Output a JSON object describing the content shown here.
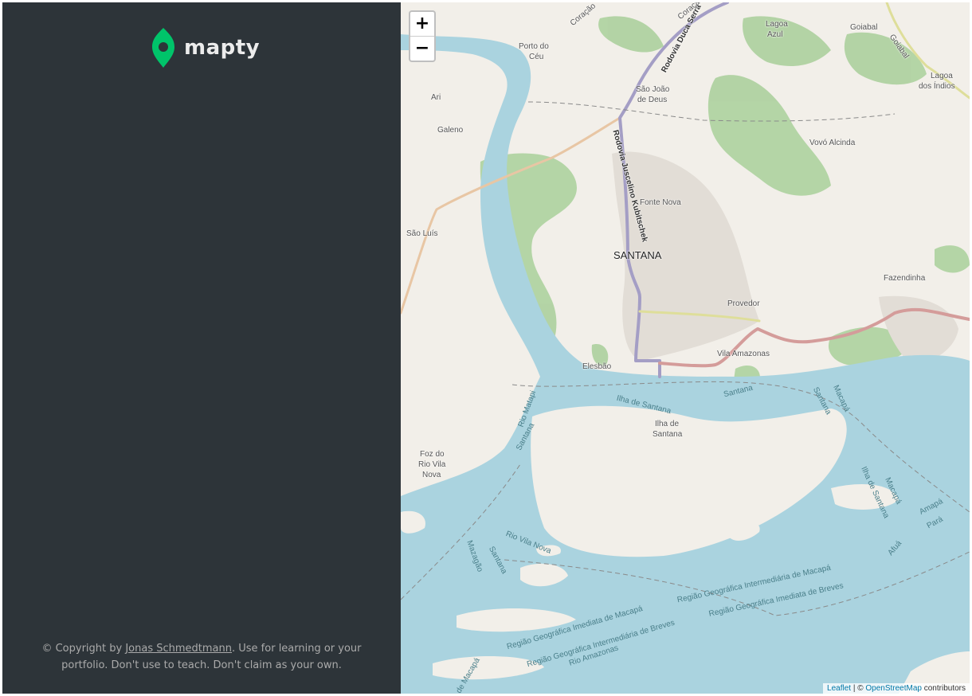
{
  "sidebar": {
    "logo_text": "mapty",
    "copyright": {
      "prefix": "© Copyright by ",
      "author": "Jonas Schmedtmann",
      "suffix": ". Use for learning or your portfolio. Don't use to teach. Don't claim as your own."
    }
  },
  "map": {
    "zoom_in": "+",
    "zoom_out": "−",
    "attribution": {
      "leaflet": "Leaflet",
      "separator": " | © ",
      "osm": "OpenStreetMap",
      "suffix": " contributors"
    },
    "labels": {
      "santana": "SANTANA",
      "fonte_nova": "Fonte Nova",
      "provedor": "Provedor",
      "vila_amazonas": "Vila Amazonas",
      "elesbao": "Elesbão",
      "fazendinha": "Fazendinha",
      "vovo_alcinda": "Vovó Alcinda",
      "sao_joao_line1": "São João",
      "sao_joao_line2": "de Deus",
      "porto_line1": "Porto do",
      "porto_line2": "Céu",
      "ari": "Ari",
      "galeno": "Galeno",
      "sao_luis": "São Luís",
      "lagoa_azul_line1": "Lagoa",
      "lagoa_azul_line2": "Azul",
      "goiabal": "Goiabal",
      "goiabal_road": "Goiabal",
      "lagoa_indios_line1": "Lagoa",
      "lagoa_indios_line2": "dos Índios",
      "ilha_santana_line1": "Ilha de",
      "ilha_santana_line2": "Santana",
      "ilha_santana_water": "Ilha de Santana",
      "foz_line1": "Foz do",
      "foz_line2": "Rio Vila",
      "foz_line3": "Nova",
      "rio_matapi": "Rio Matapi",
      "rio_vila_nova": "Rio Vila Nova",
      "rio_amazonas": "Rio Amazonas",
      "santana_water1": "Santana",
      "santana_water2": "Santana",
      "santana_water3": "Santana",
      "santana_water4": "Santana",
      "macapa_1": "Macapá",
      "macapa_2": "Macapá",
      "ilha_santana_vertical": "Ilha de Santana",
      "amapa": "Amapá",
      "para": "Pará",
      "afua": "Afuá",
      "mazagao": "Mazagão",
      "regiao_inter_macapa": "Região Geográfica Intermediária de Macapá",
      "regiao_imediata_breves": "Região Geográfica Imediata de Breves",
      "regiao_imediata_macapa": "Região Geográfica Imediata de Macapá",
      "regiao_inter_breves": "Região Geográfica Intermediária de Breves",
      "rod_duca_serra": "Rodovia Duca Serra",
      "rod_jk": "Rodovia Juscelino Kubitschek",
      "coracao": "Coração",
      "coracao_2": "Coração",
      "bottom_macapa": "de Macapá"
    }
  },
  "colors": {
    "sidebar_bg": "#2d3439",
    "brand_green": "#00c46a",
    "water": "#aad3df",
    "land": "#f2efe9",
    "forest": "#add19e"
  }
}
